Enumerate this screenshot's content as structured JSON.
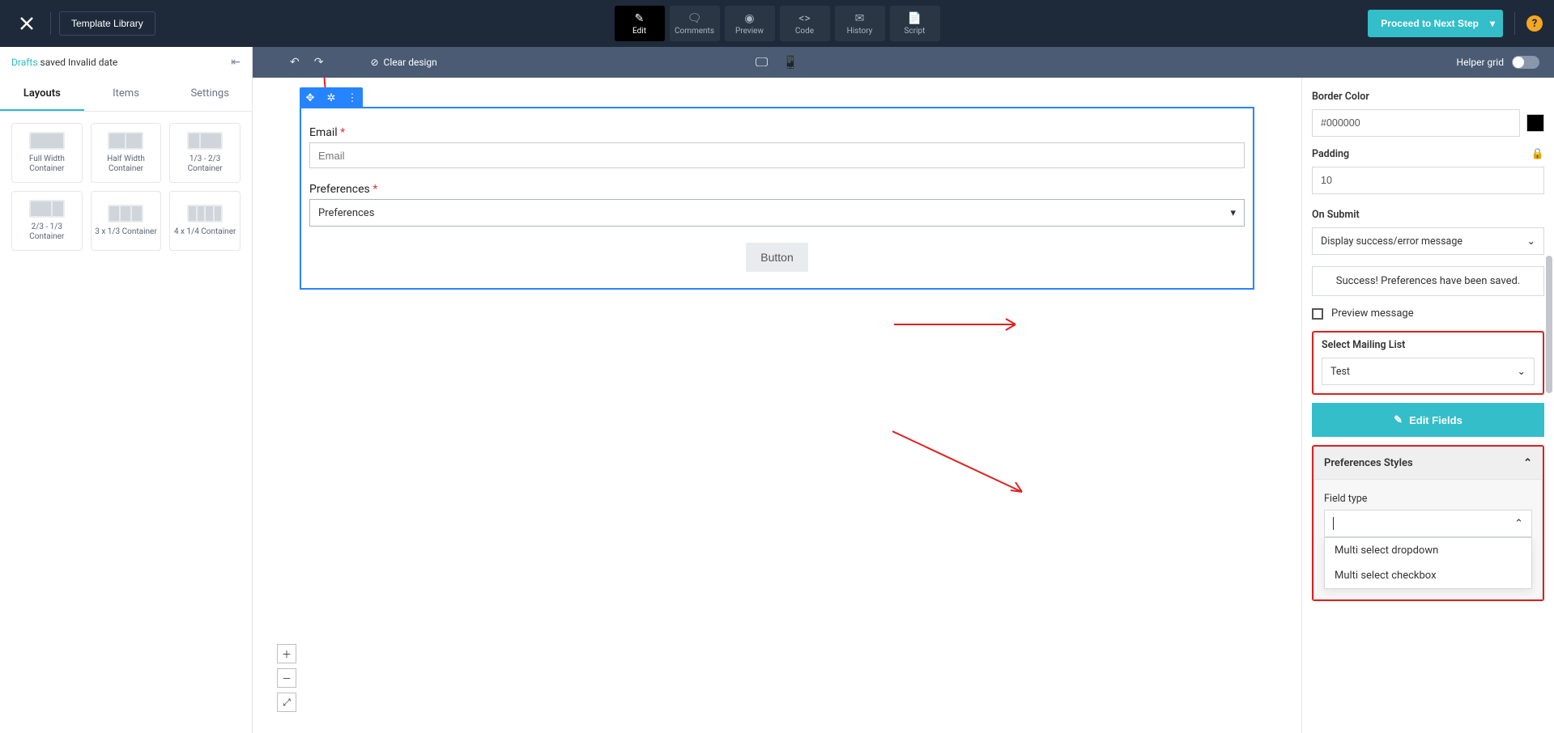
{
  "topnav": {
    "template_library": "Template Library",
    "tiles": [
      {
        "label": "Edit",
        "icon": "✎"
      },
      {
        "label": "Comments",
        "icon": "🗨"
      },
      {
        "label": "Preview",
        "icon": "👁"
      },
      {
        "label": "Code",
        "icon": "</>"
      },
      {
        "label": "History",
        "icon": "✉"
      },
      {
        "label": "Script",
        "icon": "📄"
      }
    ],
    "proceed": "Proceed to Next Step",
    "help": "?"
  },
  "secondbar": {
    "clear_design": "Clear design",
    "helper_grid": "Helper grid"
  },
  "drafts_row": {
    "drafts": "Drafts",
    "rest": " saved Invalid date"
  },
  "lp_tabs": [
    "Layouts",
    "Items",
    "Settings"
  ],
  "layouts": [
    {
      "label": "Full Width Container",
      "cols": [
        1
      ]
    },
    {
      "label": "Half Width Container",
      "cols": [
        1,
        1
      ]
    },
    {
      "label": "1/3 - 2/3 Container",
      "cols": [
        1,
        2
      ]
    },
    {
      "label": "2/3 - 1/3 Container",
      "cols": [
        2,
        1
      ]
    },
    {
      "label": "3 x 1/3 Container",
      "cols": [
        1,
        1,
        1
      ]
    },
    {
      "label": "4 x 1/4 Container",
      "cols": [
        1,
        1,
        1,
        1
      ]
    }
  ],
  "form": {
    "email_label": "Email",
    "email_placeholder": "Email",
    "pref_label": "Preferences",
    "pref_value": "Preferences",
    "button": "Button"
  },
  "rp": {
    "border_color_label": "Border Color",
    "border_color_value": "#000000",
    "padding_label": "Padding",
    "padding_value": "10",
    "on_submit_label": "On Submit",
    "on_submit_value": "Display success/error message",
    "success_msg": "Success! Preferences have been saved.",
    "preview_msg": "Preview message",
    "select_mailing_label": "Select Mailing List",
    "select_mailing_value": "Test",
    "edit_fields": "Edit Fields",
    "pref_styles_header": "Preferences Styles",
    "field_type_label": "Field type",
    "field_type_value": "",
    "options": [
      "Multi select dropdown",
      "Multi select checkbox"
    ]
  }
}
